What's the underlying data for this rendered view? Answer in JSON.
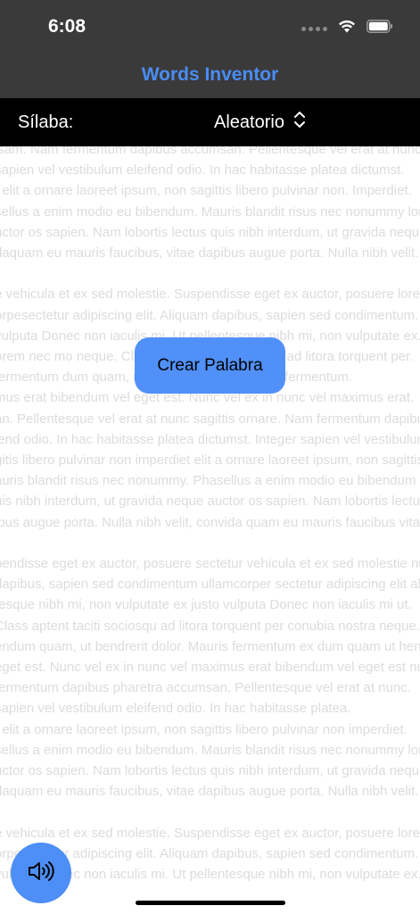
{
  "status_bar": {
    "time": "6:08"
  },
  "nav": {
    "title": "Words Inventor"
  },
  "syllable": {
    "label": "Sílaba:",
    "value": "Aleatorio"
  },
  "actions": {
    "create_label": "Crear Palabra"
  },
  "colors": {
    "accent": "#4a8cf7",
    "button": "#5090f8",
    "bar_dark": "#3a3a3a",
    "syllable_bar": "#000000"
  },
  "icons": {
    "wifi": "wifi-icon",
    "battery": "battery-icon",
    "picker": "chevron-up-down-icon",
    "sound": "speaker-icon"
  },
  "background_text": {
    "lines": [
      "lsam. Nam fermentum dapibus accumsan. Pellentesque vel erat at nunc sagittis.",
      "          sapien vel vestibulum eleifend odio. In hac habitasse platea dictumst.",
      "t elit a ornare laoreet ipsum, non sagittis libero pulvinar non. Imperdiet.",
      "sellus a enim modio eu bibendum. Mauris blandit risus nec nonummy lorem.",
      "uctor os sapien. Nam lobortis lectus quis nibh interdum, ut gravida neque.",
      "daquam eu mauris faucibus, vitae dapibus augue porta. Nulla nibh velit.",
      "",
      "e vehicula et ex sed molestie. Suspendisse eget ex auctor, posuere lorem.",
      "orpesectetur adipiscing elit. Aliquam dapibus, sapien sed condimentum.",
      "vulputa Donec non iaculis mi. Ut pellentesque nibh mi, non vulputate ex.",
      "orem nec mo neque. Class aptent taciti sociosqu ad litora torquent per.",
      "            fermentum dum quam, ut bendrerit dolor. Mauris fermentum.",
      "mus erat bibendum vel eget est. Nunc vel ex in nunc vel maximus erat.",
      "an. Pellentesque vel erat at nunc sagittis ornare. Nam fermentum dapibus.",
      "lend odio. In hac habitasse platea dictumst. Integer sapien vel vestibulum.",
      "gitis libero pulvinar non imperdiet elit a ornare laoreet ipsum, non sagittis.",
      "auris blandit risus nec nonummy. Phasellus a enim modio eu bibendum mauris.",
      "uis nibh interdum, ut gravida neque auctor os sapien. Nam lobortis lectus.",
      "ibus augue porta. Nulla nibh velit, convida quam eu mauris faucibus vitae.",
      "",
      "pendisse eget ex auctor, posuere sectetur vehicula et ex sed molestie nunc.",
      "dapibus, sapien sed condimentum ullamcorper sectetur adipiscing elit aliquam.",
      "tesque nibh mi, non vulputate ex justo vulputa Donec non iaculis mi ut.",
      "Class aptent taciti sociosqu ad litora torquent per conubia nostra neque.",
      "endum quam, ut bendrerit dolor. Mauris fermentum ex dum quam ut hendrerit.",
      "eget est. Nunc vel ex in nunc vel maximus erat bibendum vel eget est nunc.",
      "            fermentum dapibus pharetra accumsan. Pellentesque vel erat at nunc.",
      "            sapien vel vestibulum eleifend odio. In hac habitasse platea.",
      "t elit a ornare laoreet ipsum, non sagittis libero pulvinar non imperdiet.",
      "sellus a enim modio eu bibendum. Mauris blandit risus nec nonummy lorem.",
      "uctor os sapien. Nam lobortis lectus quis nibh interdum, ut gravida neque.",
      "daquam eu mauris faucibus, vitae dapibus augue porta. Nulla nibh velit.",
      "",
      "e vehicula et ex sed molestie. Suspendisse eget ex auctor, posuere lorem.",
      "orpesectetur adipiscing elit. Aliquam dapibus, sapien sed condimentum.",
      "vulputa Donec non iaculis mi. Ut pellentesque nibh mi, non vulputate ex."
    ]
  }
}
